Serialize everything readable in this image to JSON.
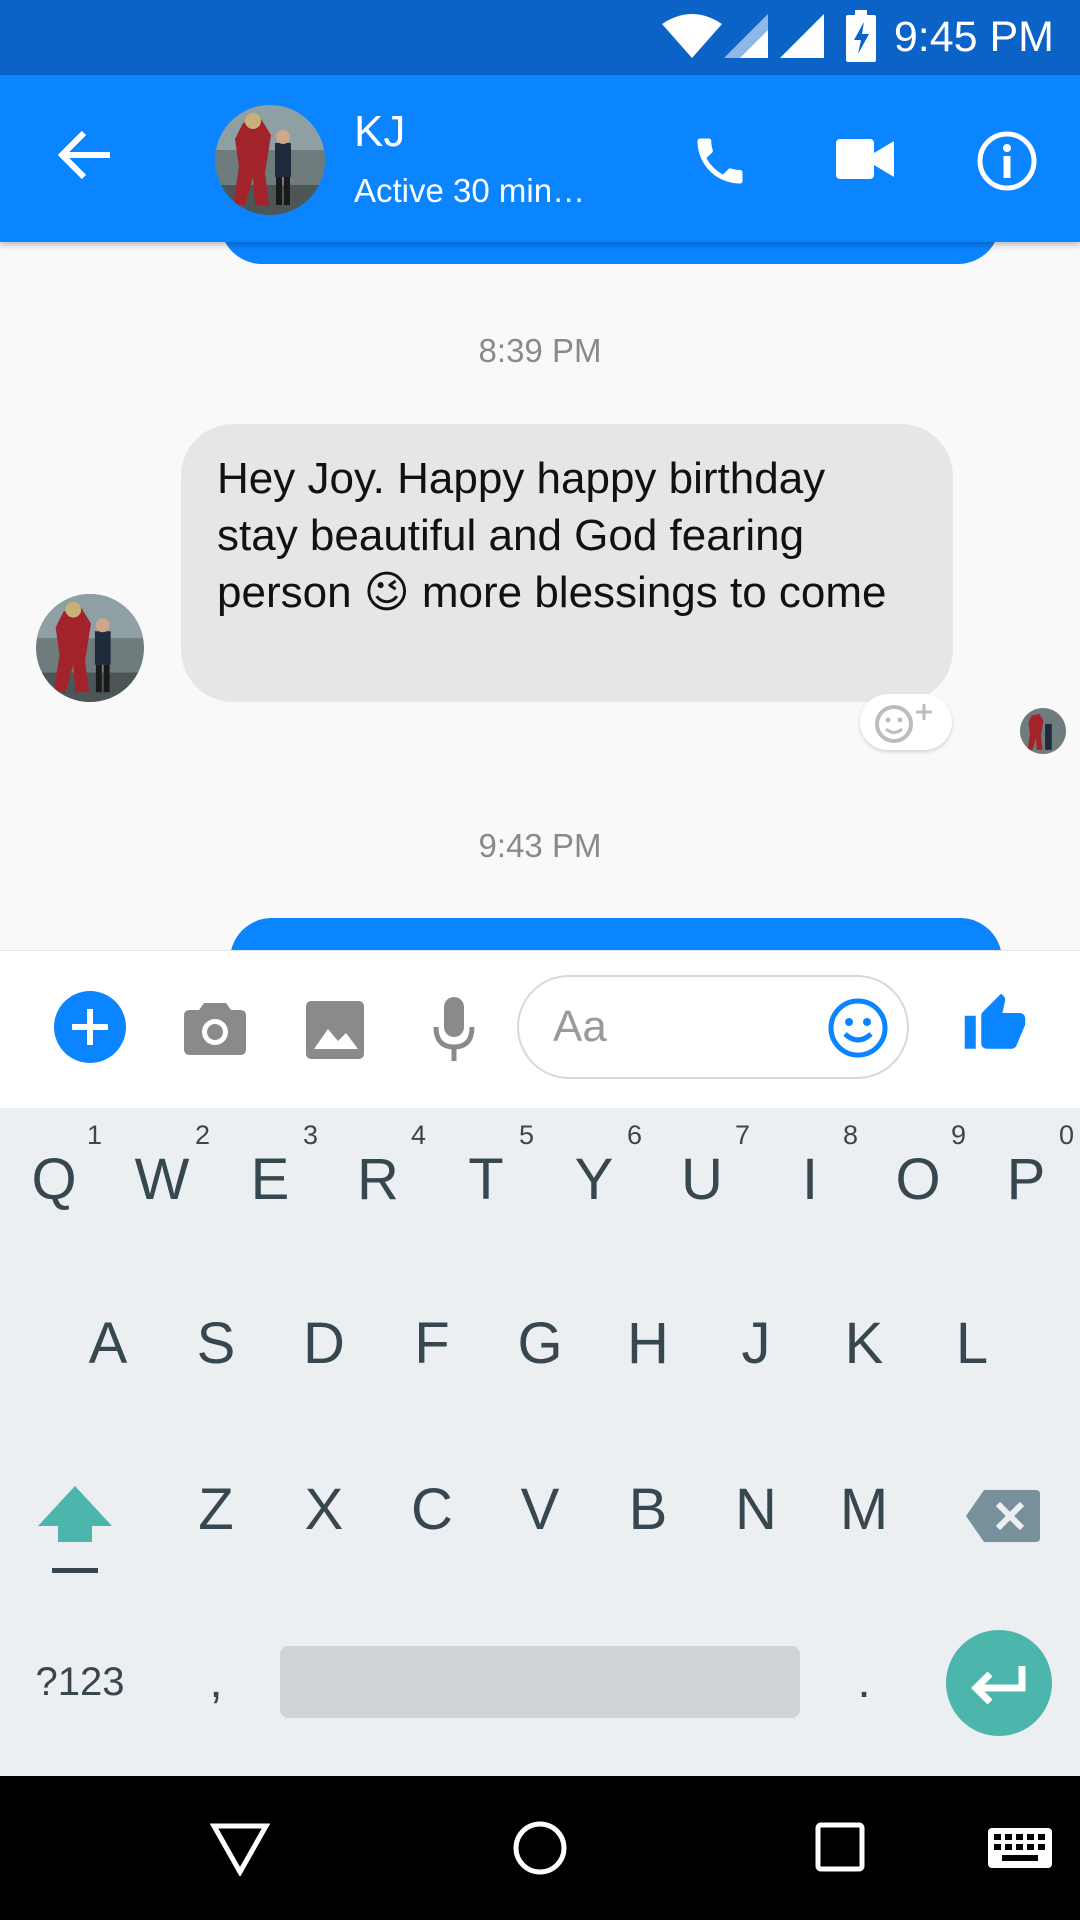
{
  "status_bar": {
    "time": "9:45 PM"
  },
  "header": {
    "contact_name": "KJ",
    "contact_status": "Active 30 min…"
  },
  "conversation": {
    "timestamps": [
      "8:39 PM",
      "9:43 PM"
    ],
    "received_message": "Hey Joy. Happy happy birthday stay beautiful and God fearing person 😉 more blessings to come"
  },
  "composer": {
    "placeholder": "Aa"
  },
  "keyboard": {
    "row1": [
      {
        "label": "Q",
        "hint": "1"
      },
      {
        "label": "W",
        "hint": "2"
      },
      {
        "label": "E",
        "hint": "3"
      },
      {
        "label": "R",
        "hint": "4"
      },
      {
        "label": "T",
        "hint": "5"
      },
      {
        "label": "Y",
        "hint": "6"
      },
      {
        "label": "U",
        "hint": "7"
      },
      {
        "label": "I",
        "hint": "8"
      },
      {
        "label": "O",
        "hint": "9"
      },
      {
        "label": "P",
        "hint": "0"
      }
    ],
    "row2": [
      "A",
      "S",
      "D",
      "F",
      "G",
      "H",
      "J",
      "K",
      "L"
    ],
    "row3": [
      "Z",
      "X",
      "C",
      "V",
      "B",
      "N",
      "M"
    ],
    "symbols_label": "?123",
    "comma_label": ",",
    "period_label": "."
  },
  "colors": {
    "brand_blue": "#0a84ff",
    "status_bar": "#0b63c8",
    "keyboard_accent": "#4db6ac"
  }
}
